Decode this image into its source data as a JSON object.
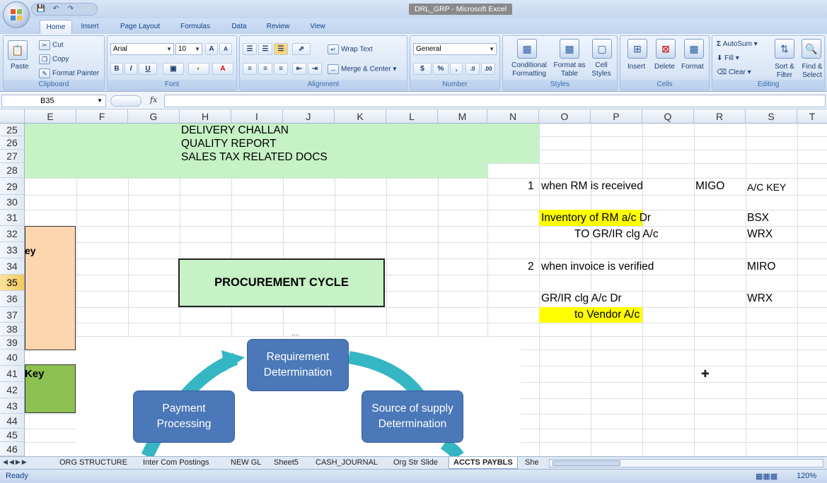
{
  "window": {
    "title": "DRL_GRP - Microsoft Excel"
  },
  "tabs": [
    "Home",
    "Insert",
    "Page Layout",
    "Formulas",
    "Data",
    "Review",
    "View"
  ],
  "ribbon": {
    "clipboard": {
      "label": "Clipboard",
      "paste": "Paste",
      "cut": "Cut",
      "copy": "Copy",
      "format_painter": "Format Painter"
    },
    "font": {
      "label": "Font",
      "name": "Arial",
      "size": "10",
      "bold": "B",
      "italic": "I",
      "underline": "U",
      "grow": "A",
      "shrink": "A"
    },
    "alignment": {
      "label": "Alignment",
      "wrap": "Wrap Text",
      "merge": "Merge & Center"
    },
    "number": {
      "label": "Number",
      "format": "General",
      "currency": "$",
      "percent": "%",
      "comma": ","
    },
    "styles": {
      "label": "Styles",
      "conditional": "Conditional Formatting",
      "format_table": "Format as Table",
      "cell_styles": "Cell Styles"
    },
    "cells": {
      "label": "Cells",
      "insert": "Insert",
      "delete": "Delete",
      "format": "Format"
    },
    "editing": {
      "label": "Editing",
      "autosum": "AutoSum",
      "fill": "Fill",
      "clear": "Clear",
      "sort": "Sort & Filter",
      "find": "Find & Select"
    }
  },
  "formula_bar": {
    "name_box": "B35",
    "fx": "fx",
    "content": ""
  },
  "columns": [
    "E",
    "F",
    "G",
    "H",
    "I",
    "J",
    "K",
    "L",
    "M",
    "N",
    "O",
    "P",
    "Q",
    "R",
    "S",
    "T"
  ],
  "rows": [
    "25",
    "26",
    "27",
    "28",
    "29",
    "30",
    "31",
    "32",
    "33",
    "34",
    "35",
    "36",
    "37",
    "38",
    "39",
    "40",
    "41",
    "42",
    "43",
    "44",
    "45",
    "46"
  ],
  "selected_row": "35",
  "cells": {
    "h25": "DELIVERY CHALLAN",
    "h26": "QUALITY REPORT",
    "h27": "SALES TAX RELATED DOCS",
    "n29": "1",
    "o29": "when RM is received",
    "r29": "MIGO",
    "s29": "A/C KEY",
    "o31": "Inventory of RM a/c Dr",
    "s31": "BSX",
    "o32": "TO   GR/IR clg A/c",
    "s32": "WRX",
    "n34": "2",
    "o34": "when invoice is verified",
    "s34": "MIRO",
    "o36": "GR/IR clg A/c    Dr",
    "s36": "WRX",
    "o37": "to Vendor A/c",
    "e33": "ey",
    "e41": "Key",
    "procurement": "PROCUREMENT CYCLE",
    "ellipsis": "...."
  },
  "diagram": {
    "nodes": [
      "Requirement Determination",
      "Payment Processing",
      "Source of supply Determination"
    ],
    "color": "#4a78b8",
    "arrow_color": "#35b6c4"
  },
  "highlight_colors": {
    "green": "#c6f2c6",
    "yellow": "#ffff00",
    "peach": "#fdd6b0",
    "olive": "#8cc152"
  },
  "sheets": [
    "ORG STRUCTURE",
    "Inter Com Postings",
    "NEW GL",
    "Sheet5",
    "CASH_JOURNAL",
    "Org Str Slide",
    "ACCTS PAYBLS",
    "She"
  ],
  "active_sheet": "ACCTS PAYBLS",
  "status": {
    "ready": "Ready",
    "zoom": "120%"
  }
}
